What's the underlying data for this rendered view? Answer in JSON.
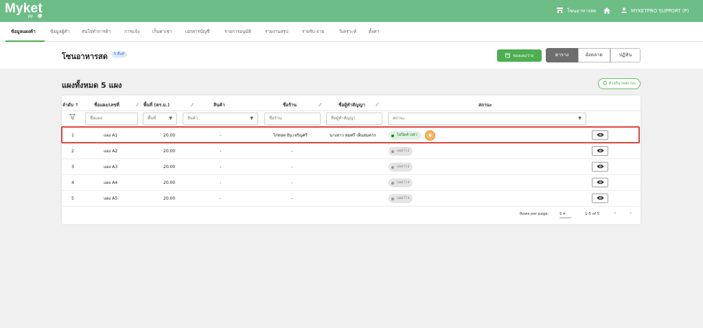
{
  "app": {
    "logo": "Myket",
    "logo_sub": "pp"
  },
  "topbar": {
    "zone_label": "โซนอาหารสด",
    "user_label": "MYKETPRO SUPPORT (P)"
  },
  "nav": {
    "items": [
      "ข้อมูลแผงค้า",
      "ข้อมูลผู้ค้า",
      "สนใจทำการค้า",
      "การแจ้ง",
      "เก็บค่าเช่า",
      "เอกสารบัญชี",
      "รายการอนุมัติ",
      "รายงานสรุป",
      "รายรับ-จ่าย",
      "วิเคราะห์",
      "ตั้งค่า"
    ],
    "active_index": 0
  },
  "header": {
    "title": "โซนอาหารสด",
    "badge": "5 พื้นที่",
    "book_button": "จองแผงว่าง",
    "views": [
      "ตาราง",
      "ผังตลาด",
      "ปฏิทิน"
    ],
    "active_view": 0
  },
  "section": {
    "title": "แผงทั้งหมด 5 แผง",
    "status_desc_button": "คำอธิบายสถานะ"
  },
  "table": {
    "headers": {
      "index": "ลำดับ",
      "stall": "ชื่อแผง/เลขที่",
      "area": "พื้นที่ (ตร.ม.)",
      "product": "สินค้า",
      "shop": "ชื่อร้าน",
      "signer": "ชื่อผู้ทำสัญญา",
      "status": "สถานะ"
    },
    "filters": {
      "stall": "ชื่อแผง",
      "area": "พื้นที่",
      "product": "สินค้า",
      "shop": "ชื่อร้าน",
      "signer": "ชื่อผู้ทำสัญญา",
      "status": "สถานะ"
    },
    "rows": [
      {
        "index": "1",
        "stall": "แผง A1",
        "area": "20.00",
        "product": "-",
        "shop": "ไก่ทอด By.เจริญศรี",
        "signer": "นางสาว สมศรี เพ็นสมควร",
        "status": "ไม่ปิดค้างค่า",
        "status_type": "overdue"
      },
      {
        "index": "2",
        "stall": "แผง A2",
        "area": "20.00",
        "product": "-",
        "shop": "-",
        "signer": "",
        "status": "แผงว่าง",
        "status_type": "empty"
      },
      {
        "index": "3",
        "stall": "แผง A3",
        "area": "20.00",
        "product": "-",
        "shop": "-",
        "signer": "",
        "status": "แผงว่าง",
        "status_type": "empty"
      },
      {
        "index": "4",
        "stall": "แผง A4",
        "area": "20.00",
        "product": "-",
        "shop": "-",
        "signer": "",
        "status": "แผงว่าง",
        "status_type": "empty"
      },
      {
        "index": "5",
        "stall": "แผง A5",
        "area": "20.00",
        "product": "-",
        "shop": "-",
        "signer": "",
        "status": "แผงว่าง",
        "status_type": "empty"
      }
    ]
  },
  "pagination": {
    "rows_per_page_label": "Rows per page:",
    "rows_per_page": "5",
    "range": "1-5 of 5"
  },
  "colors": {
    "brand_green": "#6dbd86",
    "accent_green": "#4caf50",
    "highlight_red": "#d9453a"
  }
}
